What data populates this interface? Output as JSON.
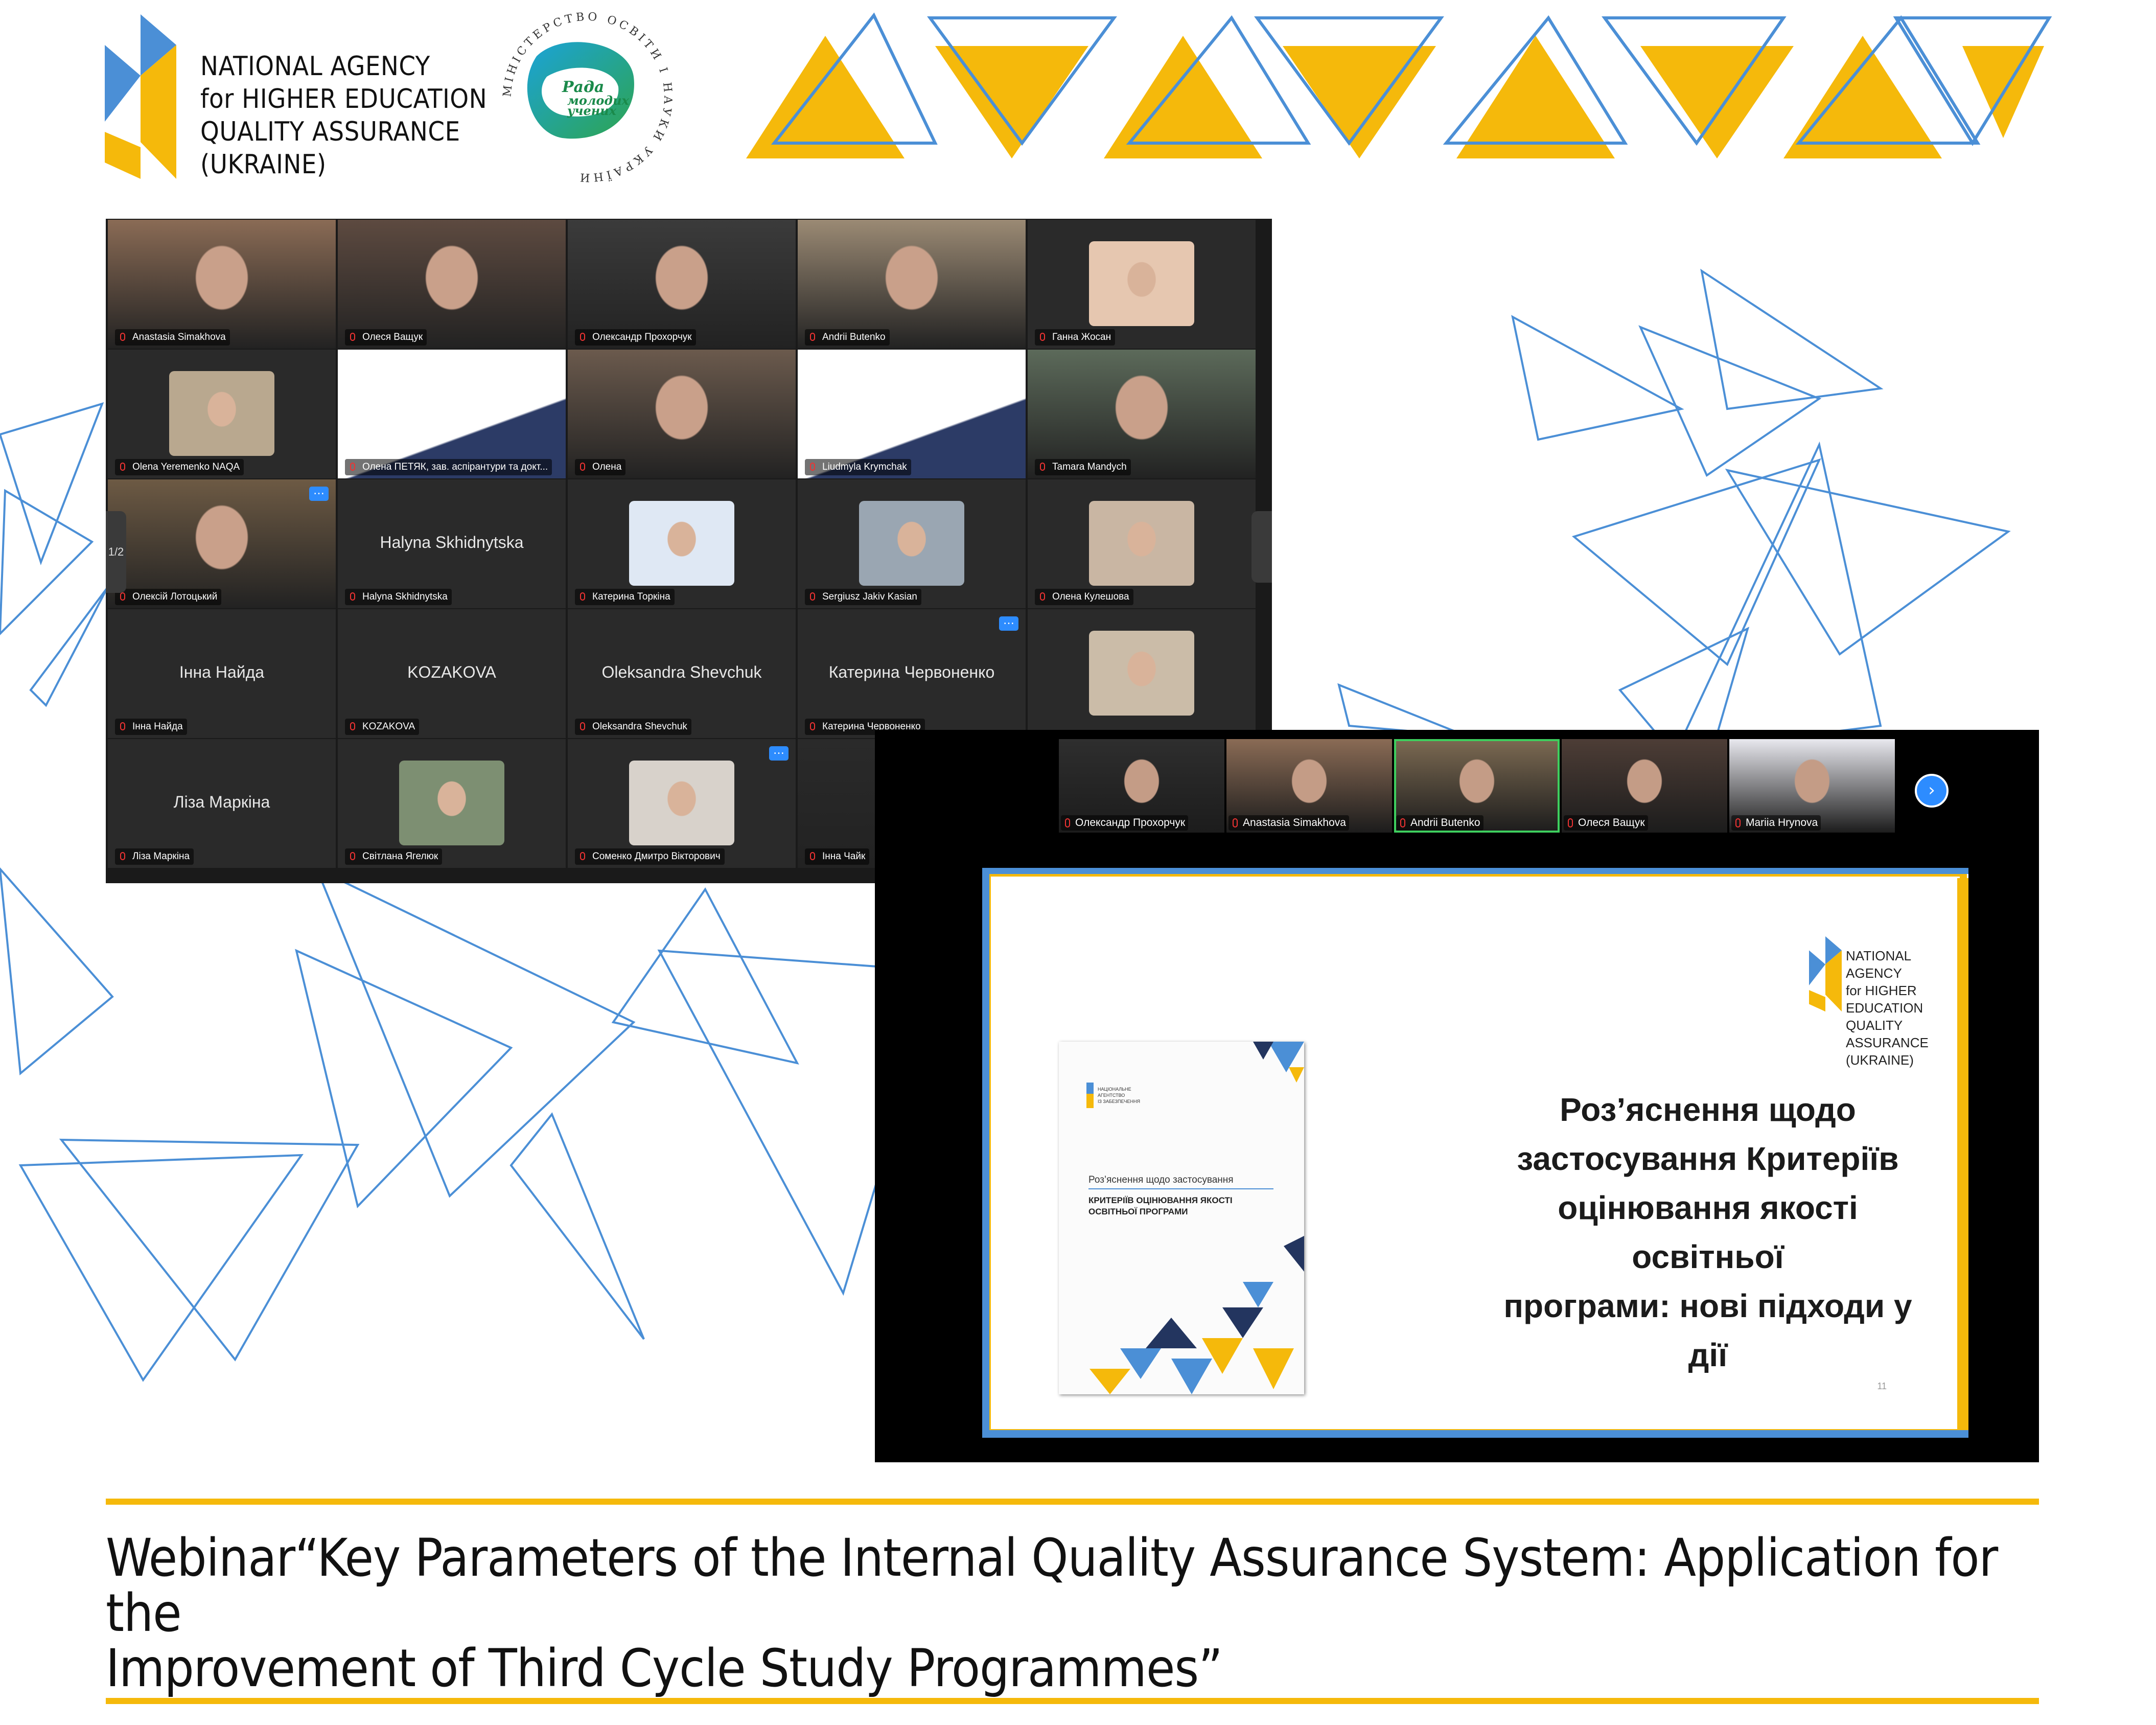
{
  "header": {
    "agency_lines": [
      "NATIONAL AGENCY",
      "for HIGHER EDUCATION",
      "QUALITY ASSURANCE",
      "(UKRAINE)"
    ],
    "council_ring_text": "МІНІСТЕРСТВО ОСВІТИ І НАУКИ УКРАЇНИ",
    "council_name_lines": [
      "Рада",
      "молодих",
      "учених"
    ]
  },
  "colors": {
    "brand_yellow": "#f5b90b",
    "brand_blue": "#4b8fd6",
    "zoom_active_border": "#3ecf5e",
    "zoom_blue": "#2d8cff"
  },
  "gallery": {
    "page_indicator": "1/2",
    "tiles": [
      {
        "name": "Anastasia Simakhova",
        "kind": "video",
        "tone": "#8a6b55"
      },
      {
        "name": "Олеся Ващук",
        "kind": "video",
        "tone": "#5d4a40"
      },
      {
        "name": "Олександр Прохорчук",
        "kind": "video",
        "tone": "#3b3b3b"
      },
      {
        "name": "Andrii Butenko",
        "kind": "video",
        "tone": "#9b8a74",
        "active": true
      },
      {
        "name": "Ганна Жосан",
        "kind": "avatar",
        "tone": "#e6c7b0"
      },
      {
        "name": "Olena Yeremenko NAQA",
        "kind": "avatar",
        "tone": "#b9a88f"
      },
      {
        "name": "Олена ПЕТЯК, зав. аспірантури та докт...",
        "kind": "slide",
        "tone": "#ffffff"
      },
      {
        "name": "Олена",
        "kind": "video",
        "tone": "#6b5a4d"
      },
      {
        "name": "Liudmyla Krymchak",
        "kind": "slide",
        "tone": "#ffffff"
      },
      {
        "name": "Tamara Mandych",
        "kind": "video",
        "tone": "#5c6a5a"
      },
      {
        "name": "Олексій Лотоцький",
        "kind": "video",
        "tone": "#6d5a44",
        "menu": true
      },
      {
        "name": "Halyna Skhidnytska",
        "kind": "name",
        "display": "Halyna Skhidnytska"
      },
      {
        "name": "Катерина Торкіна",
        "kind": "avatar",
        "tone": "#dfe8f4"
      },
      {
        "name": "Sergiusz Jakiv Kasian",
        "kind": "avatar",
        "tone": "#9aa6b2"
      },
      {
        "name": "Олена Кулешова",
        "kind": "avatar",
        "tone": "#c9b6a3"
      },
      {
        "name": "Інна Найда",
        "kind": "name",
        "display": "Інна Найда"
      },
      {
        "name": "KOZAKOVA",
        "kind": "name",
        "display": "KOZAKOVA"
      },
      {
        "name": "Oleksandra Shevchuk",
        "kind": "name",
        "display": "Oleksandra Shevchuk"
      },
      {
        "name": "Катерина Червоненко",
        "kind": "name",
        "display": "Катерина Червоненко",
        "menu": true
      },
      {
        "name": "",
        "kind": "avatar",
        "tone": "#cbbca8"
      },
      {
        "name": "Ліза Маркіна",
        "kind": "name",
        "display": "Ліза Маркіна"
      },
      {
        "name": "Світлана Ягелюк",
        "kind": "avatar",
        "tone": "#7d8f72"
      },
      {
        "name": "Соменко Дмитро Вікторович",
        "kind": "avatar",
        "tone": "#d8d2cb",
        "menu": true
      },
      {
        "name": "Інна Чайк",
        "kind": "video",
        "tone": "#2a2a2a"
      }
    ]
  },
  "speaker_strip": {
    "tiles": [
      {
        "name": "Олександр Прохорчук",
        "tone": "#2e2e2e"
      },
      {
        "name": "Anastasia Simakhova",
        "tone": "#8a6b55"
      },
      {
        "name": "Andrii Butenko",
        "tone": "#7c6a52",
        "active": true
      },
      {
        "name": "Олеся Ващук",
        "tone": "#4d3d36"
      },
      {
        "name": "Mariia Hrynova",
        "tone": "#e8e8ee"
      }
    ],
    "next_icon": "›"
  },
  "slide": {
    "logo_lines": [
      "NATIONAL AGENCY",
      "for HIGHER EDUCATION",
      "QUALITY ASSURANCE",
      "(UKRAINE)"
    ],
    "title_lines": [
      "Роз’яснення щодо",
      "застосування Критеріїв",
      "оцінювання якості освітньої",
      "програми: нові підходи у дії"
    ],
    "brochure_subtitle": "Роз’яснення щодо застосування",
    "brochure_title_lines": [
      "КРИТЕРІЇВ ОЦІНЮВАННЯ ЯКОСТІ",
      "ОСВІТНЬОЇ ПРОГРАМИ"
    ],
    "page_number": "11"
  },
  "footer": {
    "caption_lines": [
      "Webinar“Key Parameters of the Internal Quality Assurance System: Application for the",
      "Improvement of Third Cycle Study Programmes”"
    ]
  }
}
